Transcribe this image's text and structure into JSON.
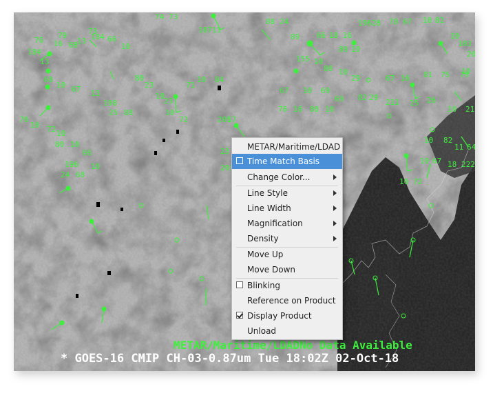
{
  "display": {
    "no_data_caption": "METAR/Maritime/LDADNo Data Available",
    "product_caption": "* GOES-16 CMIP CH-03-0.87um   Tue 18:02Z 02-Oct-18",
    "plot_color": "#3cf03c",
    "observations": [
      "79",
      "76",
      "73",
      "184",
      "13",
      "16",
      "66",
      "10",
      "68",
      "74",
      "73",
      "187",
      "11",
      "88",
      "24",
      "89",
      "66",
      "18",
      "16",
      "196",
      "28",
      "78",
      "67",
      "10",
      "82",
      "10",
      "103",
      "202",
      "10",
      "89",
      "10",
      "155",
      "10",
      "80",
      "10",
      "29",
      "67",
      "16",
      "81",
      "75",
      "75",
      "184",
      "13",
      "68",
      "10",
      "67",
      "13",
      "198",
      "25",
      "88",
      "80",
      "23",
      "10",
      "23",
      "71",
      "10",
      "84",
      "72",
      "10",
      "70",
      "10",
      "72",
      "10",
      "205",
      "17",
      "83",
      "10",
      "67",
      "10",
      "69",
      "69",
      "76",
      "16",
      "80",
      "10",
      "82",
      "29",
      "211",
      "25",
      "26",
      "10",
      "212",
      "23",
      "203",
      "10",
      "80",
      "10",
      "66",
      "10",
      "196",
      "24",
      "68",
      "10",
      "82",
      "10",
      "67",
      "10",
      "72",
      "18",
      "222",
      "11",
      "64",
      "67",
      "10",
      "69",
      "10",
      "71",
      "10",
      "26",
      "10"
    ]
  },
  "context_menu": {
    "items": [
      {
        "label": "METAR/Maritime/LDAD",
        "checkbox": false,
        "submenu": false
      },
      {
        "label": "Time Match Basis",
        "checkbox": true,
        "checked": false,
        "submenu": false,
        "highlighted": true
      },
      {
        "label": "Change Color...",
        "checkbox": false,
        "submenu": true
      },
      {
        "label": "Line Style",
        "checkbox": false,
        "submenu": true
      },
      {
        "label": "Line Width",
        "checkbox": false,
        "submenu": true
      },
      {
        "label": "Magnification",
        "checkbox": false,
        "submenu": true
      },
      {
        "label": "Density",
        "checkbox": false,
        "submenu": true
      },
      {
        "label": "Move Up",
        "checkbox": false,
        "submenu": false
      },
      {
        "label": "Move Down",
        "checkbox": false,
        "submenu": false
      },
      {
        "label": "Blinking",
        "checkbox": true,
        "checked": false,
        "submenu": false
      },
      {
        "label": "Reference on Product",
        "checkbox": false,
        "submenu": false
      },
      {
        "label": "Display Product",
        "checkbox": true,
        "checked": true,
        "submenu": false
      },
      {
        "label": "Unload",
        "checkbox": false,
        "submenu": false
      }
    ],
    "highlight_color": "#4a90d9"
  }
}
